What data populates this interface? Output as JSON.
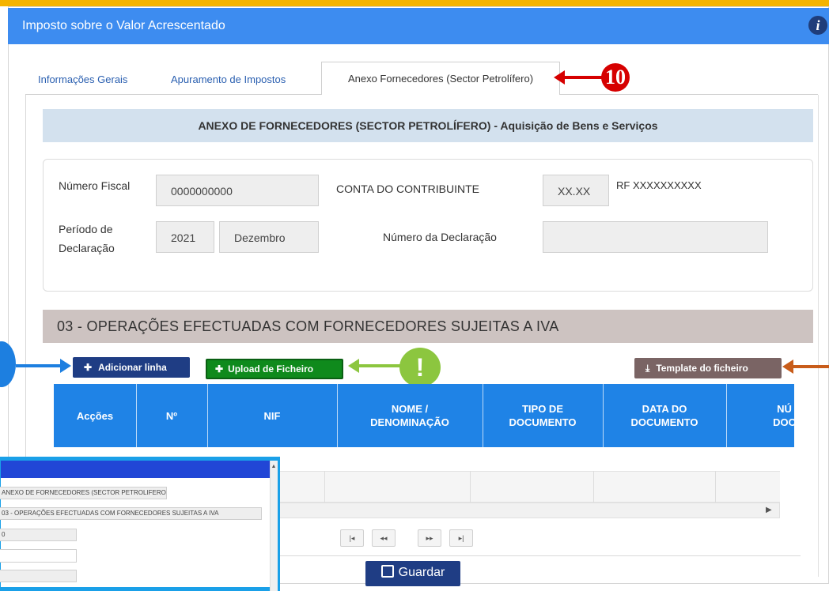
{
  "header": {
    "title": "Imposto sobre o Valor Acrescentado",
    "info_icon": "info-icon"
  },
  "tabs": [
    {
      "label": "Informações Gerais",
      "active": false
    },
    {
      "label": "Apuramento de Impostos",
      "active": false
    },
    {
      "label": "Anexo Fornecedores (Sector Petrolífero)",
      "active": true
    }
  ],
  "markers": {
    "step": "10",
    "alert": "!"
  },
  "annex": {
    "title": "ANEXO DE FORNECEDORES (SECTOR PETROLÍFERO) - Aquisição de Bens e Serviços"
  },
  "form": {
    "nif_label": "Número Fiscal",
    "nif_value": "0000000000",
    "account_label": "CONTA DO CONTRIBUINTE",
    "account_value": "XX.XX",
    "rf_value": "RF XXXXXXXXXX",
    "period_label_1": "Período de",
    "period_label_2": "Declaração",
    "year": "2021",
    "month": "Dezembro",
    "declaration_label": "Número da Declaração",
    "declaration_value": ""
  },
  "section": {
    "title": "03 - OPERAÇÕES EFECTUADAS COM FORNECEDORES SUJEITAS A IVA"
  },
  "buttons": {
    "add_row": "Adicionar linha",
    "upload": "Upload de Ficheiro",
    "template": "Template do ficheiro",
    "save": "Guardar"
  },
  "table": {
    "columns": [
      {
        "line1": "Acções",
        "line2": ""
      },
      {
        "line1": "Nº",
        "line2": ""
      },
      {
        "line1": "NIF",
        "line2": ""
      },
      {
        "line1": "NOME /",
        "line2": "DENOMINAÇÃO"
      },
      {
        "line1": "TIPO DE",
        "line2": "DOCUMENTO"
      },
      {
        "line1": "DATA DO",
        "line2": "DOCUMENTO"
      },
      {
        "line1": "NÚ",
        "line2": "DOC"
      }
    ]
  },
  "pagination": {
    "first": "|◂",
    "prev": "◂◂",
    "next": "▸▸",
    "last": "▸|"
  },
  "inset": {
    "annex_box": "ANEXO DE FORNECEDORES (SECTOR PETROLIFERO)",
    "section_box": "03 - OPERAÇÕES EFECTUADAS COM FORNECEDORES SUJEITAS A IVA",
    "field_value": "0"
  },
  "colors": {
    "header": "#3d8cf0",
    "table_header": "#1f83e6",
    "add_button": "#1f3d84",
    "upload_button": "#0f8a1c",
    "template_button": "#7a6464",
    "marker_red": "#d60000",
    "marker_green": "#8cc63f"
  }
}
